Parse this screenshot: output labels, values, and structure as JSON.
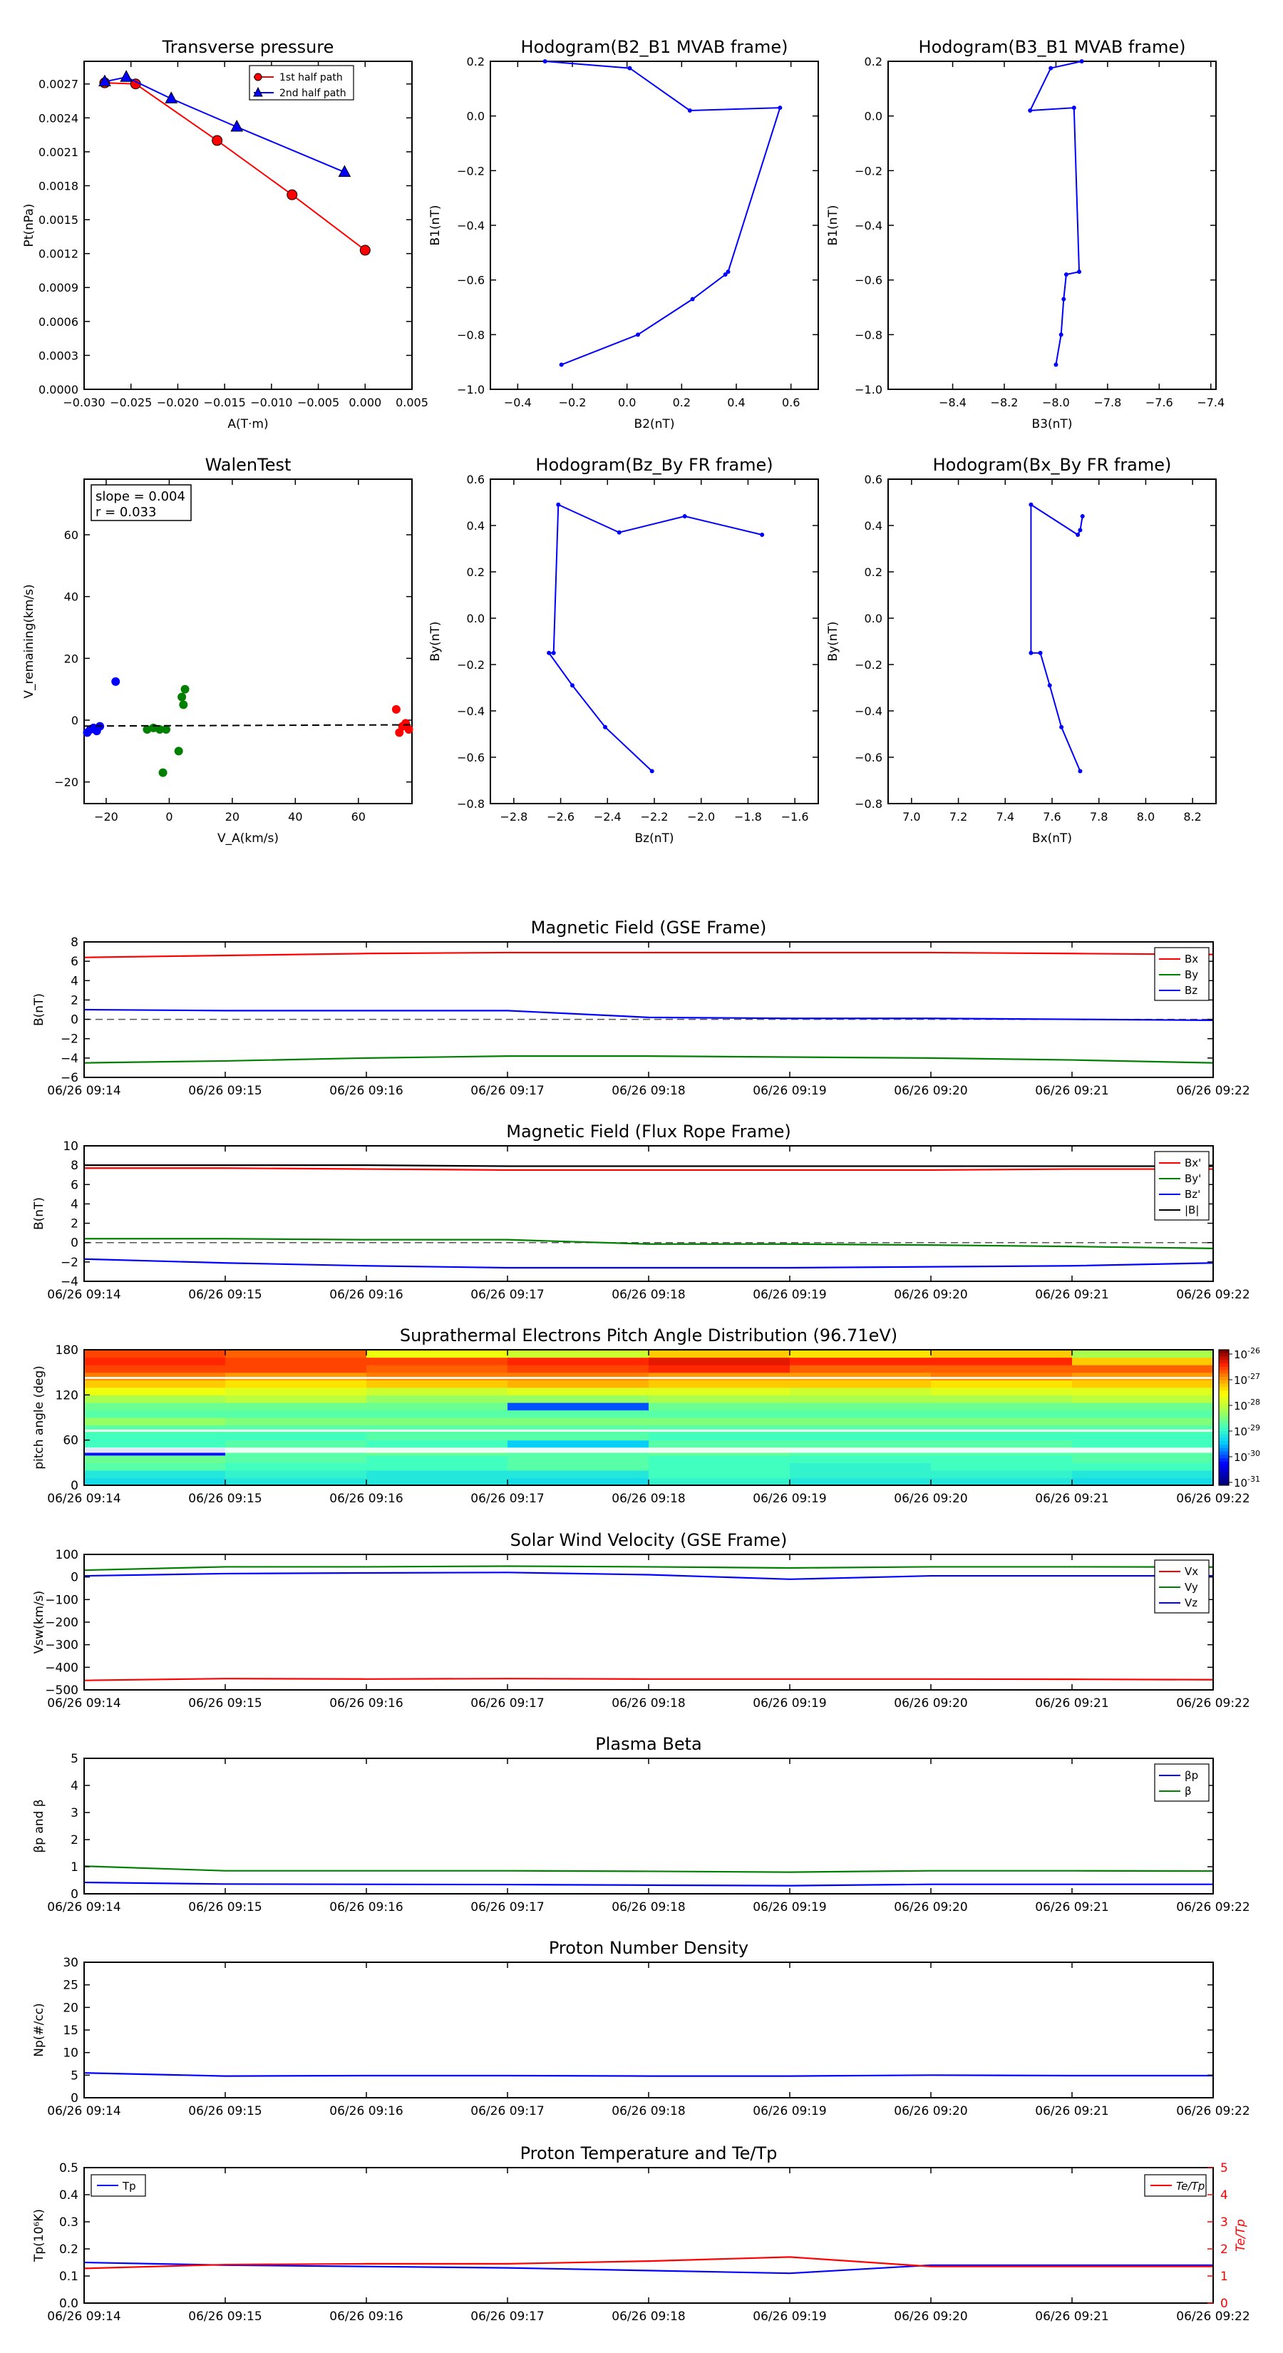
{
  "timeTicks": [
    "06/26 09:14",
    "06/26 09:15",
    "06/26 09:16",
    "06/26 09:17",
    "06/26 09:18",
    "06/26 09:19",
    "06/26 09:20",
    "06/26 09:21",
    "06/26 09:22"
  ],
  "chart_data": [
    {
      "type": "line",
      "title": "Transverse pressure",
      "xlabel": "A(T·m)",
      "ylabel": "Pt(nPa)",
      "xlim": [
        -0.03,
        0.005
      ],
      "ylim": [
        0,
        0.0029
      ],
      "xticks": [
        -0.03,
        -0.025,
        -0.02,
        -0.015,
        -0.01,
        -0.005,
        0,
        0.005
      ],
      "xtickLabels": [
        "−0.030",
        "−0.025",
        "−0.020",
        "−0.015",
        "−0.010",
        "−0.005",
        "0.000",
        "0.005"
      ],
      "yticks": [
        0,
        0.0003,
        0.0006,
        0.0009,
        0.0012,
        0.0015,
        0.0018,
        0.0021,
        0.0024,
        0.0027
      ],
      "ytickLabels": [
        "0.0000",
        "0.0003",
        "0.0006",
        "0.0009",
        "0.0012",
        "0.0015",
        "0.0018",
        "0.0021",
        "0.0024",
        "0.0027"
      ],
      "legend": "upper-center",
      "series": [
        {
          "name": "1st half path",
          "color": "#ff0000",
          "marker": "circle",
          "x": [
            -0.0278,
            -0.0245,
            -0.0158,
            -0.0078,
            0.0
          ],
          "y": [
            0.00271,
            0.0027,
            0.0022,
            0.00172,
            0.00123
          ]
        },
        {
          "name": "2nd half path",
          "color": "#0000ff",
          "marker": "triangle",
          "x": [
            -0.0278,
            -0.0255,
            -0.0207,
            -0.0137,
            -0.0022
          ],
          "y": [
            0.00272,
            0.00276,
            0.00257,
            0.00232,
            0.00192
          ]
        }
      ]
    },
    {
      "type": "line",
      "title": "Hodogram(B2_B1 MVAB frame)",
      "xlabel": "B2(nT)",
      "ylabel": "B1(nT)",
      "xlim": [
        -0.5,
        0.7
      ],
      "ylim": [
        -1.0,
        0.2
      ],
      "xticks": [
        -0.4,
        -0.2,
        0.0,
        0.2,
        0.4,
        0.6
      ],
      "xtickLabels": [
        "−0.4",
        "−0.2",
        "0.0",
        "0.2",
        "0.4",
        "0.6"
      ],
      "yticks": [
        -1.0,
        -0.8,
        -0.6,
        -0.4,
        -0.2,
        0.0,
        0.2
      ],
      "ytickLabels": [
        "−1.0",
        "−0.8",
        "−0.6",
        "−0.4",
        "−0.2",
        "0.0",
        "0.2"
      ],
      "series": [
        {
          "color": "#0000ff",
          "x": [
            -0.3,
            0.01,
            0.23,
            0.56,
            0.37,
            0.36,
            0.24,
            0.04,
            -0.24
          ],
          "y": [
            0.2,
            0.175,
            0.02,
            0.03,
            -0.57,
            -0.58,
            -0.67,
            -0.8,
            -0.91
          ]
        }
      ]
    },
    {
      "type": "line",
      "title": "Hodogram(B3_B1 MVAB frame)",
      "xlabel": "B3(nT)",
      "ylabel": "B1(nT)",
      "xlim": [
        -8.65,
        -7.38
      ],
      "ylim": [
        -1.0,
        0.2
      ],
      "xticks": [
        -8.4,
        -8.2,
        -8.0,
        -7.8,
        -7.6,
        -7.4
      ],
      "xtickLabels": [
        "−8.4",
        "−8.2",
        "−8.0",
        "−7.8",
        "−7.6",
        "−7.4"
      ],
      "yticks": [
        -1.0,
        -0.8,
        -0.6,
        -0.4,
        -0.2,
        0.0,
        0.2
      ],
      "ytickLabels": [
        "−1.0",
        "−0.8",
        "−0.6",
        "−0.4",
        "−0.2",
        "0.0",
        "0.2"
      ],
      "series": [
        {
          "color": "#0000ff",
          "x": [
            -7.9,
            -8.02,
            -8.1,
            -7.93,
            -7.91,
            -7.96,
            -7.97,
            -7.98,
            -8.0
          ],
          "y": [
            0.2,
            0.175,
            0.02,
            0.03,
            -0.57,
            -0.58,
            -0.67,
            -0.8,
            -0.91
          ]
        }
      ]
    },
    {
      "type": "scatter",
      "title": "WalenTest",
      "xlabel": "V_A(km/s)",
      "ylabel": "V_remaining(km/s)",
      "xlim": [
        -27,
        77
      ],
      "ylim": [
        -27,
        78
      ],
      "xticks": [
        -20,
        0,
        20,
        40,
        60
      ],
      "xtickLabels": [
        "−20",
        "0",
        "20",
        "40",
        "60"
      ],
      "yticks": [
        -20,
        0,
        20,
        40,
        60
      ],
      "ytickLabels": [
        "−20",
        "0",
        "20",
        "40",
        "60"
      ],
      "annotation": [
        "slope = 0.004",
        "r = 0.033"
      ],
      "series": [
        {
          "color": "#0000ff",
          "x": [
            -26,
            -25,
            -24,
            -23,
            -22,
            -17
          ],
          "y": [
            -4,
            -3,
            -2.5,
            -3.5,
            -2,
            12.5
          ]
        },
        {
          "color": "#008000",
          "x": [
            -7,
            -5,
            -3,
            -2,
            -1,
            3,
            4,
            4.5,
            5
          ],
          "y": [
            -3,
            -2.5,
            -3,
            -17,
            -3,
            -10,
            7.5,
            5,
            10
          ]
        },
        {
          "color": "#ff0000",
          "x": [
            72,
            73,
            74,
            75,
            76
          ],
          "y": [
            3.5,
            -4,
            -2,
            -1,
            -3
          ]
        }
      ],
      "fitLine": {
        "x": [
          -27,
          77
        ],
        "y": [
          -1.9,
          -1.5
        ]
      }
    },
    {
      "type": "line",
      "title": "Hodogram(Bz_By FR frame)",
      "xlabel": "Bz(nT)",
      "ylabel": "By(nT)",
      "xlim": [
        -2.9,
        -1.5
      ],
      "ylim": [
        -0.8,
        0.6
      ],
      "xticks": [
        -2.8,
        -2.6,
        -2.4,
        -2.2,
        -2.0,
        -1.8,
        -1.6
      ],
      "xtickLabels": [
        "−2.8",
        "−2.6",
        "−2.4",
        "−2.2",
        "−2.0",
        "−1.8",
        "−1.6"
      ],
      "yticks": [
        -0.8,
        -0.6,
        -0.4,
        -0.2,
        0.0,
        0.2,
        0.4,
        0.6
      ],
      "ytickLabels": [
        "−0.8",
        "−0.6",
        "−0.4",
        "−0.2",
        "0.0",
        "0.2",
        "0.4",
        "0.6"
      ],
      "series": [
        {
          "color": "#0000ff",
          "x": [
            -1.74,
            -2.07,
            -2.35,
            -2.61,
            -2.63,
            -2.65,
            -2.55,
            -2.41,
            -2.21
          ],
          "y": [
            0.36,
            0.44,
            0.37,
            0.49,
            -0.15,
            -0.15,
            -0.29,
            -0.47,
            -0.66
          ]
        }
      ]
    },
    {
      "type": "line",
      "title": "Hodogram(Bx_By FR frame)",
      "xlabel": "Bx(nT)",
      "ylabel": "By(nT)",
      "xlim": [
        6.9,
        8.3
      ],
      "ylim": [
        -0.8,
        0.6
      ],
      "xticks": [
        7.0,
        7.2,
        7.4,
        7.6,
        7.8,
        8.0,
        8.2
      ],
      "xtickLabels": [
        "7.0",
        "7.2",
        "7.4",
        "7.6",
        "7.8",
        "8.0",
        "8.2"
      ],
      "yticks": [
        -0.8,
        -0.6,
        -0.4,
        -0.2,
        0.0,
        0.2,
        0.4,
        0.6
      ],
      "ytickLabels": [
        "−0.8",
        "−0.6",
        "−0.4",
        "−0.2",
        "0.0",
        "0.2",
        "0.4",
        "0.6"
      ],
      "series": [
        {
          "color": "#0000ff",
          "x": [
            7.73,
            7.72,
            7.71,
            7.51,
            7.51,
            7.55,
            7.59,
            7.64,
            7.72
          ],
          "y": [
            0.44,
            0.38,
            0.36,
            0.49,
            -0.15,
            -0.15,
            -0.29,
            -0.47,
            -0.66
          ]
        }
      ]
    },
    {
      "type": "line",
      "title": "Magnetic Field (GSE Frame)",
      "ylabel": "B(nT)",
      "ylim": [
        -6,
        8
      ],
      "yticks": [
        -6,
        -4,
        -2,
        0,
        2,
        4,
        6,
        8
      ],
      "ytickLabels": [
        "−6",
        "−4",
        "−2",
        "0",
        "2",
        "4",
        "6",
        "8"
      ],
      "zeroLine": true,
      "legend": "right",
      "x": [
        0,
        1,
        2,
        3,
        4,
        5,
        6,
        7,
        8
      ],
      "series": [
        {
          "name": "Bx",
          "color": "#ff0000",
          "values": [
            6.4,
            6.6,
            6.8,
            6.9,
            6.9,
            6.9,
            6.9,
            6.8,
            6.7
          ]
        },
        {
          "name": "By",
          "color": "#008000",
          "values": [
            -4.5,
            -4.3,
            -4.0,
            -3.8,
            -3.8,
            -3.9,
            -4.0,
            -4.2,
            -4.5
          ]
        },
        {
          "name": "Bz",
          "color": "#0000ff",
          "values": [
            1.0,
            0.9,
            0.9,
            0.9,
            0.2,
            0.1,
            0.1,
            0.0,
            -0.1
          ]
        }
      ]
    },
    {
      "type": "line",
      "title": "Magnetic Field (Flux Rope Frame)",
      "ylabel": "B(nT)",
      "ylim": [
        -4,
        10
      ],
      "yticks": [
        -4,
        -2,
        0,
        2,
        4,
        6,
        8,
        10
      ],
      "ytickLabels": [
        "−4",
        "−2",
        "0",
        "2",
        "4",
        "6",
        "8",
        "10"
      ],
      "zeroLine": true,
      "legend": "right",
      "x": [
        0,
        1,
        2,
        3,
        4,
        5,
        6,
        7,
        8
      ],
      "series": [
        {
          "name": "Bx'",
          "color": "#ff0000",
          "values": [
            7.7,
            7.7,
            7.6,
            7.5,
            7.5,
            7.5,
            7.5,
            7.6,
            7.6
          ]
        },
        {
          "name": "By'",
          "color": "#008000",
          "values": [
            0.4,
            0.4,
            0.3,
            0.3,
            -0.15,
            -0.15,
            -0.25,
            -0.4,
            -0.6
          ]
        },
        {
          "name": "Bz'",
          "color": "#0000ff",
          "values": [
            -1.7,
            -2.1,
            -2.4,
            -2.6,
            -2.6,
            -2.6,
            -2.5,
            -2.4,
            -2.1
          ]
        },
        {
          "name": "|B|",
          "color": "#000000",
          "values": [
            8.0,
            8.0,
            8.0,
            7.9,
            7.9,
            7.9,
            7.9,
            7.9,
            7.9
          ]
        }
      ]
    },
    {
      "type": "heatmap",
      "title": "Suprathermal Electrons Pitch Angle Distribution (96.71eV)",
      "ylabel": "pitch angle (deg)",
      "ylim": [
        0,
        180
      ],
      "yticks": [
        0,
        60,
        120,
        180
      ],
      "ytickLabels": [
        "0",
        "60",
        "120",
        "180"
      ],
      "colorbar": {
        "ticks": [
          "10-26",
          "10-27",
          "10-28",
          "10-29",
          "10-30",
          "10-31"
        ]
      },
      "pitchBins": [
        0,
        10,
        20,
        30,
        40,
        50,
        60,
        70,
        80,
        90,
        100,
        110,
        120,
        130,
        140,
        150,
        160,
        170,
        180
      ],
      "columns": 8,
      "levels": [
        [
          3.5,
          3.6,
          3.6,
          3.5,
          3.7,
          3.6,
          3.6,
          3.5
        ],
        [
          3.6,
          3.7,
          3.6,
          3.6,
          3.8,
          3.7,
          3.7,
          3.6
        ],
        [
          3.9,
          3.8,
          3.8,
          3.9,
          3.8,
          3.7,
          3.8,
          3.8
        ],
        [
          4.0,
          3.9,
          3.8,
          3.9,
          3.8,
          3.8,
          3.8,
          3.9
        ],
        [
          2.8,
          3.9,
          4.0,
          3.9,
          4.0,
          3.9,
          3.9,
          3.9
        ],
        [
          3.8,
          3.9,
          3.8,
          3.4,
          3.9,
          3.9,
          3.9,
          3.8
        ],
        [
          3.8,
          3.8,
          3.9,
          3.9,
          3.8,
          3.8,
          3.8,
          3.8
        ],
        [
          3.9,
          3.9,
          3.9,
          3.9,
          3.9,
          3.9,
          3.9,
          3.9
        ],
        [
          4.2,
          4.1,
          4.1,
          4.1,
          4.1,
          4.1,
          4.1,
          4.1
        ],
        [
          3.9,
          3.9,
          3.9,
          3.9,
          3.9,
          3.9,
          3.9,
          3.9
        ],
        [
          4.0,
          4.0,
          4.0,
          3.0,
          4.0,
          4.0,
          4.0,
          4.0
        ],
        [
          4.3,
          4.4,
          4.2,
          4.2,
          4.3,
          4.3,
          4.3,
          4.4
        ],
        [
          4.7,
          4.6,
          4.5,
          4.6,
          4.6,
          4.5,
          4.6,
          4.6
        ],
        [
          5.0,
          4.9,
          5.0,
          5.1,
          5.0,
          5.0,
          4.9,
          5.0
        ],
        [
          5.3,
          5.2,
          5.3,
          5.3,
          5.2,
          5.2,
          5.3,
          5.2
        ],
        [
          5.5,
          5.5,
          5.4,
          5.5,
          5.6,
          5.4,
          5.4,
          5.4
        ],
        [
          5.6,
          5.5,
          5.5,
          5.6,
          5.7,
          5.6,
          5.6,
          5.0
        ],
        [
          5.5,
          5.4,
          4.7,
          4.5,
          5.0,
          4.9,
          5.0,
          4.3
        ]
      ]
    },
    {
      "type": "line",
      "title": "Solar Wind Velocity (GSE Frame)",
      "ylabel": "Vsw(km/s)",
      "ylim": [
        -500,
        100
      ],
      "yticks": [
        -500,
        -400,
        -300,
        -200,
        -100,
        0,
        100
      ],
      "ytickLabels": [
        "−500",
        "−400",
        "−300",
        "−200",
        "−100",
        "0",
        "100"
      ],
      "legend": "right",
      "x": [
        0,
        1,
        2,
        3,
        4,
        5,
        6,
        7,
        8
      ],
      "series": [
        {
          "name": "Vx",
          "color": "#ff0000",
          "values": [
            -458,
            -450,
            -452,
            -450,
            -452,
            -452,
            -452,
            -453,
            -455
          ]
        },
        {
          "name": "Vy",
          "color": "#008000",
          "values": [
            30,
            45,
            45,
            48,
            45,
            40,
            45,
            45,
            44
          ]
        },
        {
          "name": "Vz",
          "color": "#0000ff",
          "values": [
            5,
            15,
            18,
            20,
            10,
            -10,
            5,
            5,
            5
          ]
        }
      ]
    },
    {
      "type": "line",
      "title": "Plasma Beta",
      "ylabel": "βp and β",
      "ylim": [
        0,
        5
      ],
      "yticks": [
        0,
        1,
        2,
        3,
        4,
        5
      ],
      "ytickLabels": [
        "0",
        "1",
        "2",
        "3",
        "4",
        "5"
      ],
      "legend": "right",
      "x": [
        0,
        1,
        2,
        3,
        4,
        5,
        6,
        7,
        8
      ],
      "series": [
        {
          "name": "βp",
          "color": "#0000ff",
          "values": [
            0.42,
            0.36,
            0.35,
            0.34,
            0.32,
            0.3,
            0.35,
            0.35,
            0.35
          ]
        },
        {
          "name": "β",
          "color": "#008000",
          "values": [
            1.02,
            0.85,
            0.85,
            0.85,
            0.83,
            0.8,
            0.85,
            0.85,
            0.84
          ]
        }
      ]
    },
    {
      "type": "line",
      "title": "Proton Number Density",
      "ylabel": "Np(#/cc)",
      "ylim": [
        0,
        30
      ],
      "yticks": [
        0,
        5,
        10,
        15,
        20,
        25,
        30
      ],
      "ytickLabels": [
        "0",
        "5",
        "10",
        "15",
        "20",
        "25",
        "30"
      ],
      "x": [
        0,
        1,
        2,
        3,
        4,
        5,
        6,
        7,
        8
      ],
      "series": [
        {
          "color": "#0000ff",
          "values": [
            5.5,
            4.8,
            4.9,
            4.9,
            4.8,
            4.8,
            5.0,
            4.9,
            4.9
          ]
        }
      ]
    },
    {
      "type": "line",
      "title": "Proton Temperature and Te/Tp",
      "ylabel": "Tp(10⁶K)",
      "y2label": "Te/Tp",
      "ylim": [
        0,
        0.5
      ],
      "y2lim": [
        0,
        5
      ],
      "yticks": [
        0,
        0.1,
        0.2,
        0.3,
        0.4,
        0.5
      ],
      "ytickLabels": [
        "0.0",
        "0.1",
        "0.2",
        "0.3",
        "0.4",
        "0.5"
      ],
      "y2ticks": [
        0,
        1,
        2,
        3,
        4,
        5
      ],
      "y2tickLabels": [
        "0",
        "1",
        "2",
        "3",
        "4",
        "5"
      ],
      "x": [
        0,
        1,
        2,
        3,
        4,
        5,
        6,
        7,
        8
      ],
      "series": [
        {
          "name": "Tp",
          "color": "#0000ff",
          "axis": "left",
          "values": [
            0.15,
            0.14,
            0.135,
            0.13,
            0.12,
            0.11,
            0.14,
            0.14,
            0.14
          ]
        },
        {
          "name": "Te/Tp",
          "color": "#ff0000",
          "axis": "right",
          "values": [
            1.28,
            1.42,
            1.45,
            1.45,
            1.55,
            1.7,
            1.35,
            1.35,
            1.35
          ]
        }
      ]
    }
  ]
}
